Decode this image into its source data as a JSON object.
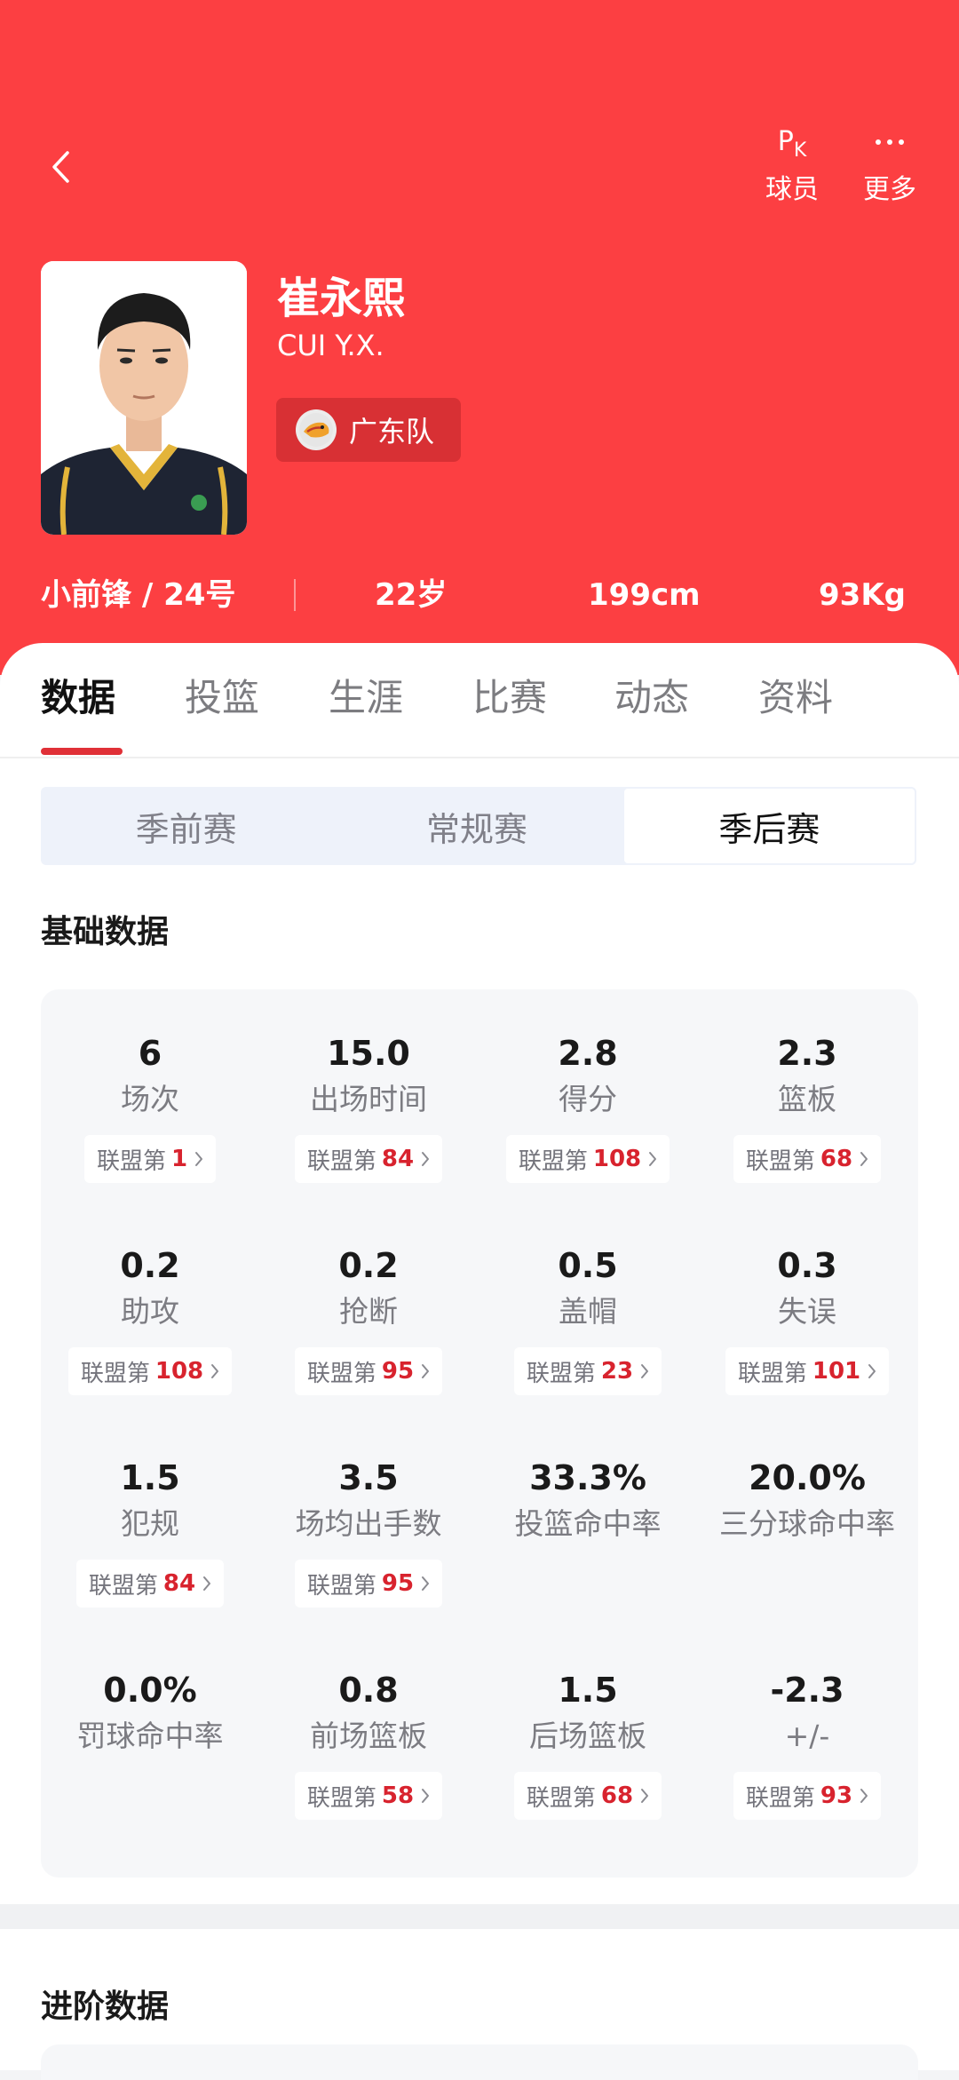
{
  "header": {
    "pk_label": "球员",
    "more_label": "更多",
    "colors": {
      "primary": "#fc3f42",
      "accent": "#d8232e"
    },
    "icons": [
      "back-arrow-icon",
      "pk-icon",
      "more-dots-icon",
      "team-logo-icon",
      "chevron-right-icon"
    ]
  },
  "player": {
    "name_cn": "崔永熙",
    "name_en": "CUI Y.X.",
    "team": "广东队",
    "position_number": "小前锋 / 24号",
    "age": "22岁",
    "height": "199cm",
    "weight": "93Kg"
  },
  "tabs": [
    "数据",
    "投篮",
    "生涯",
    "比赛",
    "动态",
    "资料"
  ],
  "active_tab": "数据",
  "season_types": [
    "季前赛",
    "常规赛",
    "季后赛"
  ],
  "active_season_type": "季后赛",
  "basic_title": "基础数据",
  "advanced_title": "进阶数据",
  "rank_prefix": "联盟第",
  "stats": [
    {
      "value": "6",
      "label": "场次",
      "rank": "1"
    },
    {
      "value": "15.0",
      "label": "出场时间",
      "rank": "84"
    },
    {
      "value": "2.8",
      "label": "得分",
      "rank": "108"
    },
    {
      "value": "2.3",
      "label": "篮板",
      "rank": "68"
    },
    {
      "value": "0.2",
      "label": "助攻",
      "rank": "108"
    },
    {
      "value": "0.2",
      "label": "抢断",
      "rank": "95"
    },
    {
      "value": "0.5",
      "label": "盖帽",
      "rank": "23"
    },
    {
      "value": "0.3",
      "label": "失误",
      "rank": "101"
    },
    {
      "value": "1.5",
      "label": "犯规",
      "rank": "84"
    },
    {
      "value": "3.5",
      "label": "场均出手数",
      "rank": "95"
    },
    {
      "value": "33.3%",
      "label": "投篮命中率",
      "rank": null
    },
    {
      "value": "20.0%",
      "label": "三分球命中率",
      "rank": null
    },
    {
      "value": "0.0%",
      "label": "罚球命中率",
      "rank": null
    },
    {
      "value": "0.8",
      "label": "前场篮板",
      "rank": "58"
    },
    {
      "value": "1.5",
      "label": "后场篮板",
      "rank": "68"
    },
    {
      "value": "-2.3",
      "label": "+/-",
      "rank": "93"
    }
  ]
}
